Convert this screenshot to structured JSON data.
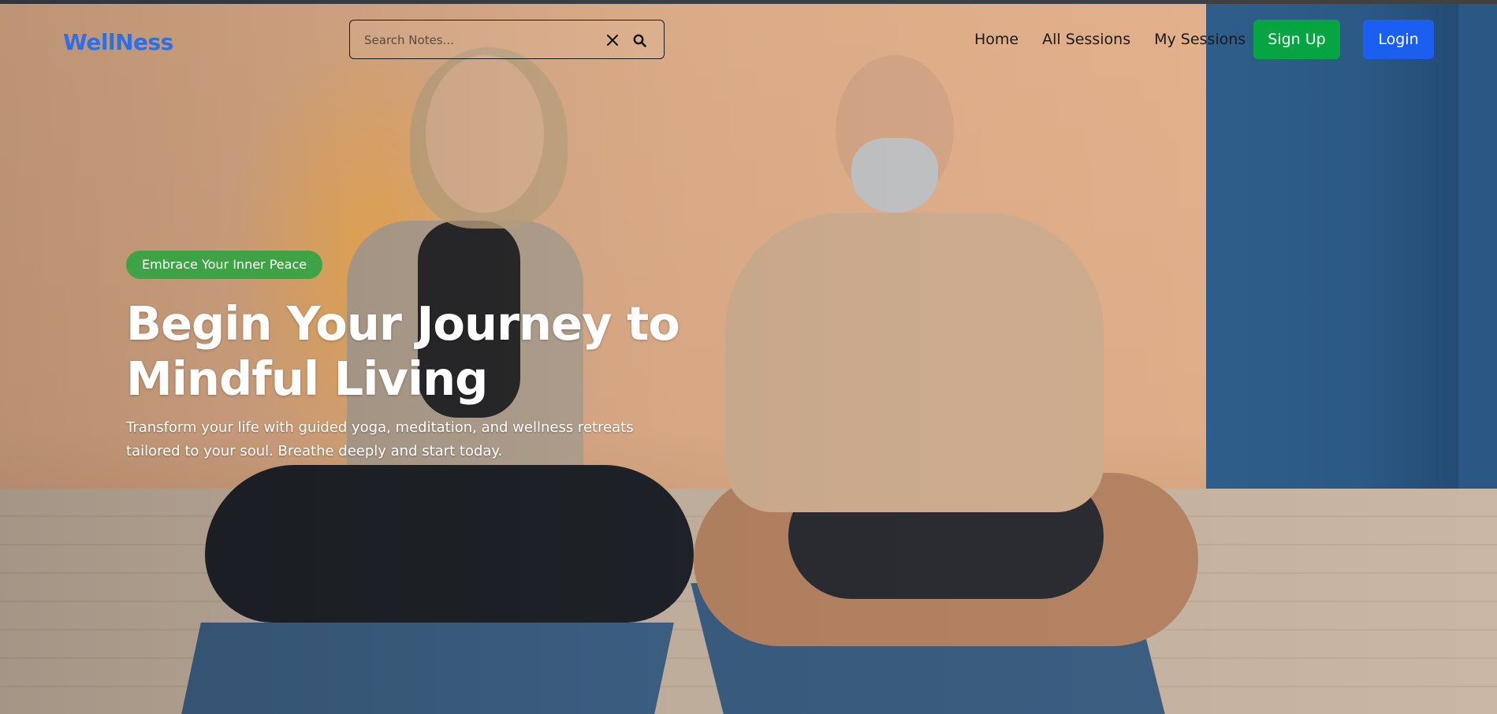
{
  "brand": {
    "logo_text": "WellNess",
    "logo_color": "#2f6fe6"
  },
  "search": {
    "placeholder": "Search Notes...",
    "value": ""
  },
  "nav": {
    "links": [
      {
        "label": "Home"
      },
      {
        "label": "All Sessions"
      },
      {
        "label": "My Sessions"
      }
    ],
    "signup_label": "Sign Up",
    "login_label": "Login"
  },
  "hero": {
    "badge": "Embrace Your Inner Peace",
    "headline_line1": "Begin Your Journey to",
    "headline_line2": "Mindful Living",
    "subtext": "Transform your life with guided yoga, meditation, and wellness retreats tailored to your soul. Breathe deeply and start today."
  },
  "colors": {
    "signup": "#06a443",
    "login": "#1b5ff0",
    "badge": "#3ea344"
  },
  "icons": {
    "clear": "close-icon",
    "search": "search-icon"
  }
}
